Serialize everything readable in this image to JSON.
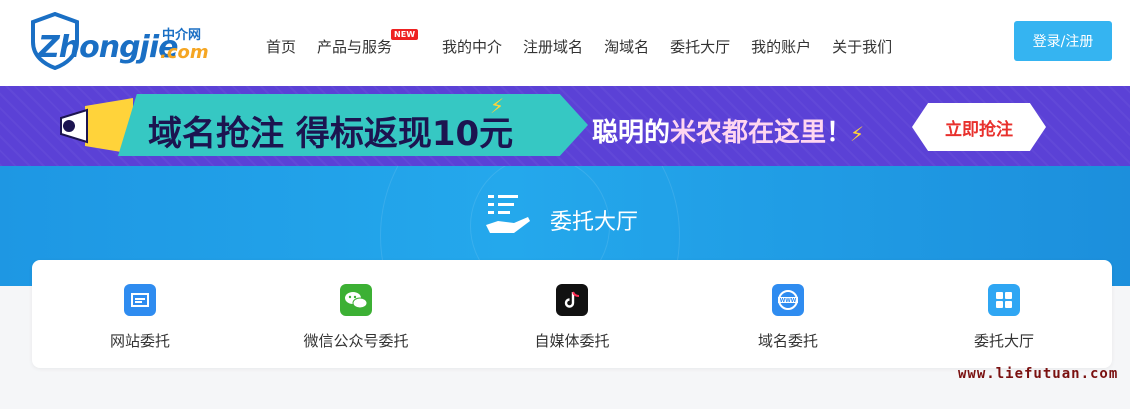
{
  "brand": {
    "wordmark": "Zhongjie",
    "cn_name": "中介网",
    "suffix": ".com"
  },
  "nav": {
    "items": [
      {
        "label": "首页"
      },
      {
        "label": "产品与服务",
        "badge": "NEW"
      },
      {
        "label": "我的中介"
      },
      {
        "label": "注册域名"
      },
      {
        "label": "淘域名"
      },
      {
        "label": "委托大厅"
      },
      {
        "label": "我的账户"
      },
      {
        "label": "关于我们"
      }
    ],
    "login_label": "登录/注册"
  },
  "banner": {
    "headline": "域名抢注  得标返现10元",
    "tagline_a": "聪明的",
    "tagline_b": "米农都在这里",
    "tagline_end": "！",
    "cta_label": "立即抢注"
  },
  "hall": {
    "title": "委托大厅"
  },
  "services": [
    {
      "label": "网站委托",
      "icon": "website-icon",
      "color": "#2f8cf0"
    },
    {
      "label": "微信公众号委托",
      "icon": "wechat-icon",
      "color": "#3cb034"
    },
    {
      "label": "自媒体委托",
      "icon": "tiktok-icon",
      "color": "#111111"
    },
    {
      "label": "域名委托",
      "icon": "domain-www-icon",
      "color": "#2f8cf0"
    },
    {
      "label": "委托大厅",
      "icon": "grid-hall-icon",
      "color": "#2fa6f3"
    }
  ],
  "watermark": "www.liefutuan.com",
  "colors": {
    "accent": "#35b4f1",
    "banner_bg": "#5b41d6",
    "hero_bg": "#1e97e3",
    "banner_cta_text": "#e8302c"
  }
}
